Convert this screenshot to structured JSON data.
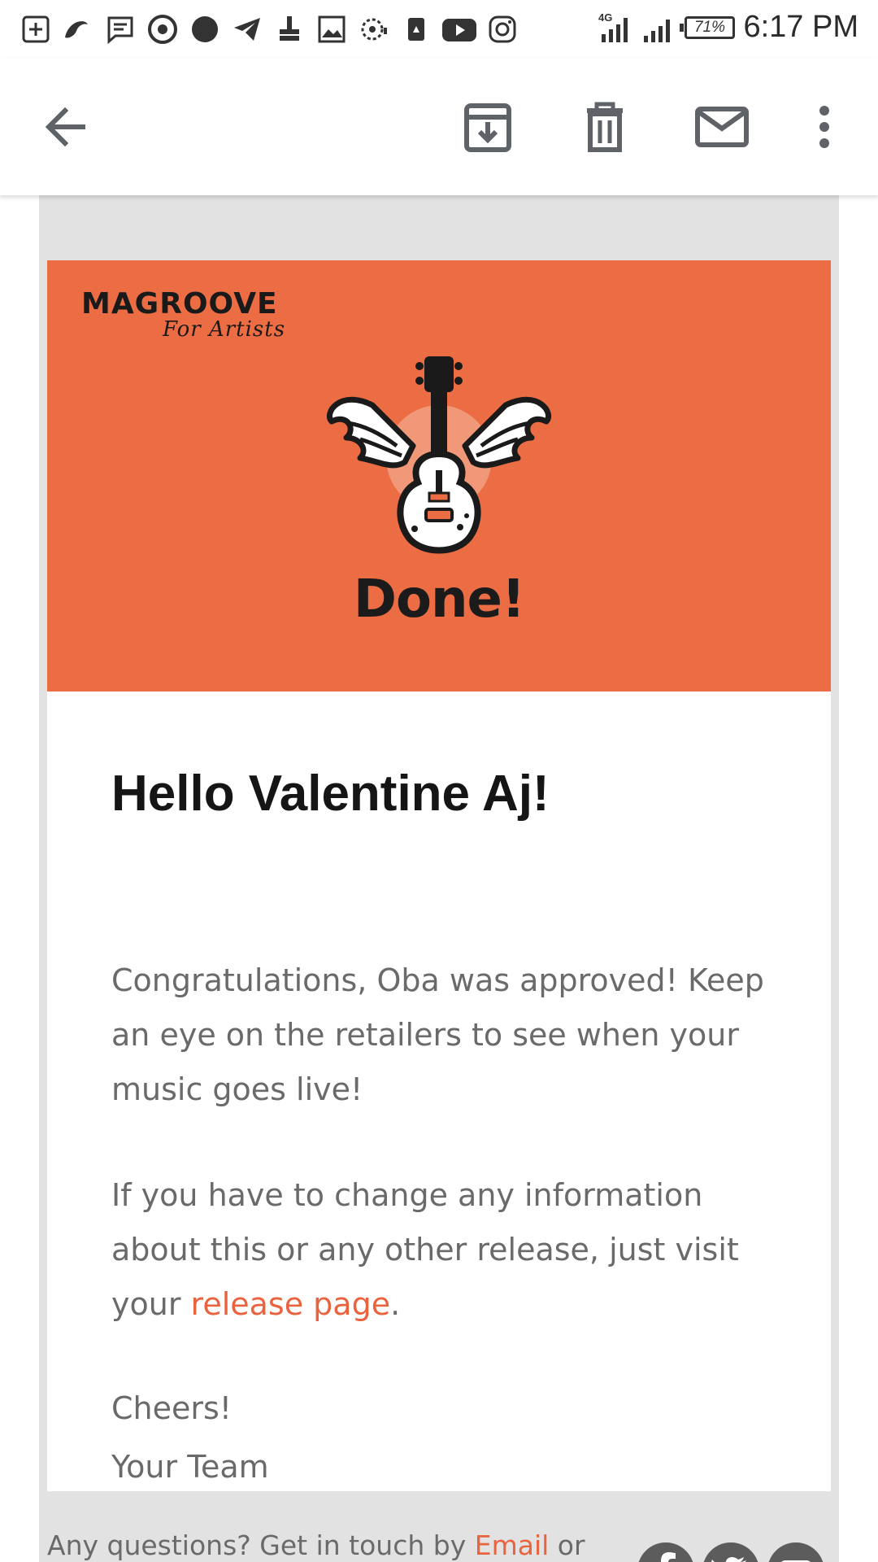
{
  "status_bar": {
    "time": "6:17 PM",
    "battery": "71%",
    "network": "4G",
    "notification_icons": [
      "add-box-icon",
      "bird-app-icon",
      "message-icon",
      "chrome-icon",
      "compass-app-icon",
      "telegram-icon",
      "cleaner-icon",
      "gallery-icon",
      "podcast-icon",
      "lock-app-icon",
      "youtube-icon",
      "instagram-icon"
    ]
  },
  "app_bar": {
    "back": "arrow-left-icon",
    "actions": [
      "archive-icon",
      "delete-icon",
      "mark-unread-icon",
      "more-vert-icon"
    ]
  },
  "email": {
    "brand": {
      "name": "MAGROOVE",
      "tagline": "For Artists"
    },
    "hero_title": "Done!",
    "hero_color": "#ec6d43",
    "greeting": "Hello Valentine Aj!",
    "para1": "Congratulations, Oba was approved! Keep an eye on the retailers to see when your music goes live!",
    "para2_before": "If you have to change any information about this or any other release, just visit your ",
    "para2_link": "release page",
    "para2_after": ".",
    "signoff_1": "Cheers!",
    "signoff_2": "Your Team",
    "link_color": "#e9643e"
  },
  "footer": {
    "text_before": "Any questions? Get in touch by ",
    "email_link": "Email",
    "text_after": " or",
    "social": [
      "facebook-icon",
      "twitter-icon",
      "youtube-icon"
    ]
  }
}
